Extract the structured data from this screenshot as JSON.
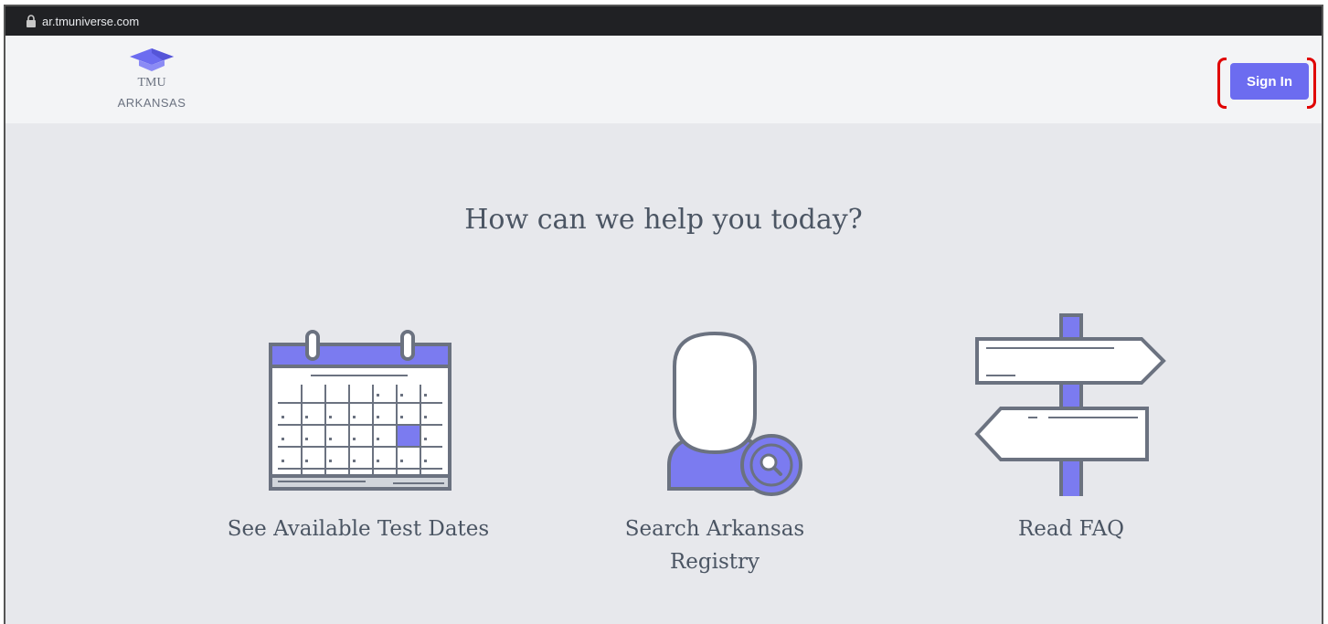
{
  "browser": {
    "url": "ar.tmuniverse.com"
  },
  "header": {
    "logo": {
      "abbr": "TMU",
      "state": "ARKANSAS"
    },
    "signin_label": "Sign In"
  },
  "main": {
    "headline": "How can we help you today?",
    "cards": [
      {
        "label": "See Available Test Dates"
      },
      {
        "label": "Search Arkansas Registry"
      },
      {
        "label": "Read FAQ"
      }
    ]
  },
  "colors": {
    "accent": "#6c6cf0",
    "annotation": "#e00000",
    "background": "#e7e8ec"
  }
}
